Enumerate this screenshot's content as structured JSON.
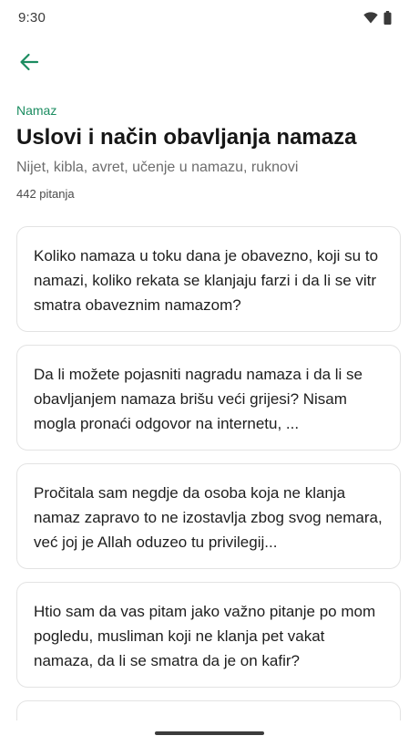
{
  "status_bar": {
    "time": "9:30",
    "icons": [
      "wifi-icon",
      "battery-icon"
    ]
  },
  "header": {
    "back_icon": "arrow-left-icon",
    "category": "Namaz",
    "title": "Uslovi i način obavljanja namaza",
    "subtitle": "Nijet, kibla, avret, učenje u namazu, ruknovi",
    "count": "442 pitanja"
  },
  "questions": [
    {
      "text": "Koliko namaza u toku dana je obavezno, koji su to namazi, koliko rekata se klanjaju farzi i da li se vitr smatra obaveznim namazom?"
    },
    {
      "text": "Da li možete pojasniti nagradu namaza i da li se obavljanjem namaza brišu veći grijesi? Nisam mogla pronaći odgovor na internetu, ..."
    },
    {
      "text": "Pročitala sam negdje da osoba koja ne klanja namaz zapravo to ne izostavlja zbog svog nemara, već joj je Allah oduzeo tu privilegij..."
    },
    {
      "text": "Htio sam da vas pitam jako važno pitanje po mom pogledu, musliman koji ne klanja pet vakat namaza, da li se smatra da je on kafir?"
    },
    {
      "text": ""
    }
  ],
  "colors": {
    "accent": "#1b8c60",
    "title": "#161616",
    "subtitle": "#6d6d6d",
    "card_border": "#e3e3e3"
  }
}
